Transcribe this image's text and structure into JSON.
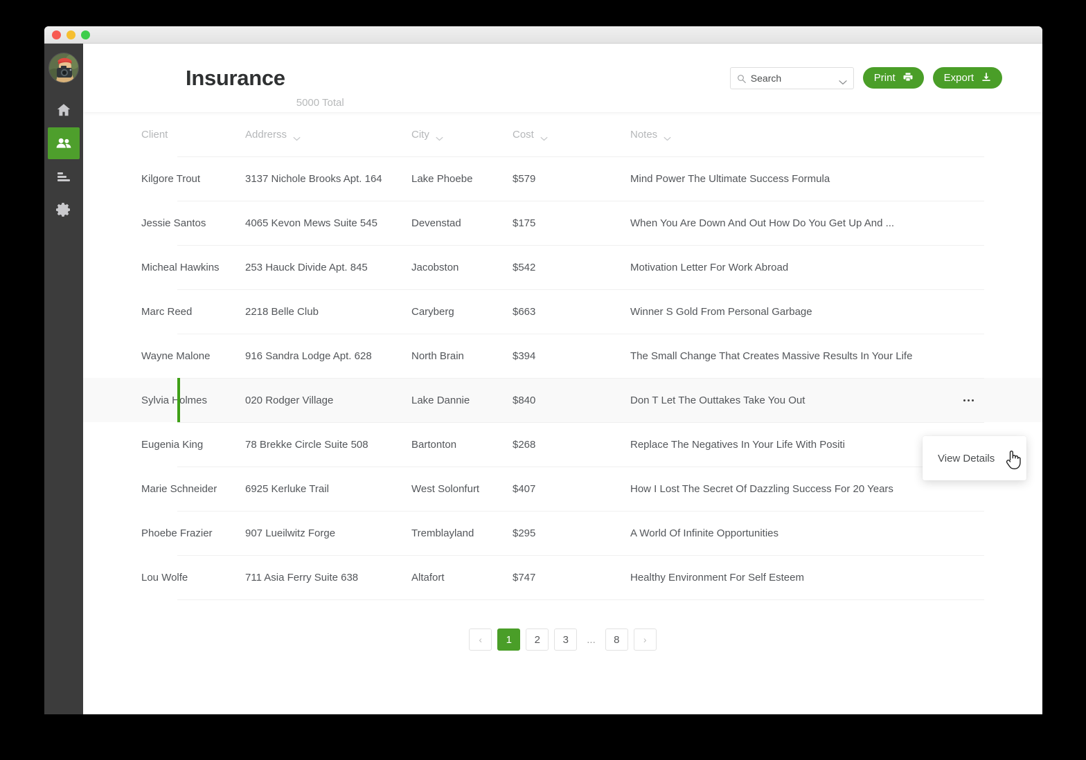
{
  "window": {
    "traffic_lights": [
      "close",
      "minimize",
      "zoom"
    ]
  },
  "sidebar": {
    "avatar_name": "user-avatar-photographer",
    "items": [
      {
        "icon": "home-icon",
        "name": "home",
        "active": false
      },
      {
        "icon": "people-icon",
        "name": "clients",
        "active": true
      },
      {
        "icon": "bars-icon",
        "name": "reports",
        "active": false
      },
      {
        "icon": "gear-icon",
        "name": "settings",
        "active": false
      }
    ]
  },
  "header": {
    "title": "Insurance",
    "total": "5000 Total"
  },
  "search": {
    "placeholder": "Search",
    "value": "",
    "icon": "search-icon",
    "chevron": "chevron-down-icon"
  },
  "buttons": {
    "print": {
      "label": "Print",
      "icon": "printer-icon"
    },
    "export": {
      "label": "Export",
      "icon": "download-icon"
    }
  },
  "colors": {
    "accent_green": "#4a9e28",
    "selected_bar_green": "#3fa017",
    "sidebar_dark": "#3c3c3c",
    "text_primary": "#53565a",
    "text_muted": "#b5b7b9"
  },
  "table": {
    "columns": [
      {
        "key": "client",
        "label": "Client",
        "sortable": false
      },
      {
        "key": "address",
        "label": "Addrerss",
        "sortable": true
      },
      {
        "key": "city",
        "label": "City",
        "sortable": true
      },
      {
        "key": "cost",
        "label": "Cost",
        "sortable": true
      },
      {
        "key": "notes",
        "label": "Notes",
        "sortable": true
      }
    ],
    "rows": [
      {
        "client": "Kilgore Trout",
        "address": "3137 Nichole Brooks Apt. 164",
        "city": "Lake Phoebe",
        "cost": "$579",
        "notes": "Mind Power The Ultimate Success Formula",
        "selected": false
      },
      {
        "client": "Jessie Santos",
        "address": "4065 Kevon Mews Suite 545",
        "city": "Devenstad",
        "cost": "$175",
        "notes": "When You Are Down And Out How Do You Get Up And ...",
        "selected": false
      },
      {
        "client": "Micheal Hawkins",
        "address": "253 Hauck Divide Apt. 845",
        "city": "Jacobston",
        "cost": "$542",
        "notes": "Motivation Letter For Work Abroad",
        "selected": false
      },
      {
        "client": "Marc Reed",
        "address": "2218 Belle Club",
        "city": "Caryberg",
        "cost": "$663",
        "notes": "Winner S Gold From Personal Garbage",
        "selected": false
      },
      {
        "client": "Wayne Malone",
        "address": "916 Sandra Lodge Apt. 628",
        "city": "North Brain",
        "cost": "$394",
        "notes": "The Small Change That Creates Massive Results In Your Life",
        "selected": false
      },
      {
        "client": "Sylvia Holmes",
        "address": "020 Rodger Village",
        "city": "Lake Dannie",
        "cost": "$840",
        "notes": "Don T Let The Outtakes Take You Out",
        "selected": true
      },
      {
        "client": "Eugenia King",
        "address": "78 Brekke Circle Suite 508",
        "city": "Bartonton",
        "cost": "$268",
        "notes": "Replace The Negatives In Your Life With Positi",
        "selected": false
      },
      {
        "client": "Marie Schneider",
        "address": "6925 Kerluke Trail",
        "city": "West Solonfurt",
        "cost": "$407",
        "notes": "How I Lost The Secret Of Dazzling Success For 20 Years",
        "selected": false
      },
      {
        "client": "Phoebe Frazier",
        "address": "907 Lueilwitz Forge",
        "city": "Tremblayland",
        "cost": "$295",
        "notes": "A World Of Infinite Opportunities",
        "selected": false
      },
      {
        "client": "Lou Wolfe",
        "address": "711 Asia Ferry Suite 638",
        "city": "Altafort",
        "cost": "$747",
        "notes": "Healthy Environment For Self Esteem",
        "selected": false
      }
    ]
  },
  "row_menu": {
    "trigger_icon": "more-horizontal-icon",
    "items": [
      {
        "label": "View Details"
      }
    ]
  },
  "pagination": {
    "prev": "‹",
    "next": "›",
    "ellipsis": "...",
    "pages": [
      "1",
      "2",
      "3",
      "8"
    ],
    "current": "1"
  }
}
